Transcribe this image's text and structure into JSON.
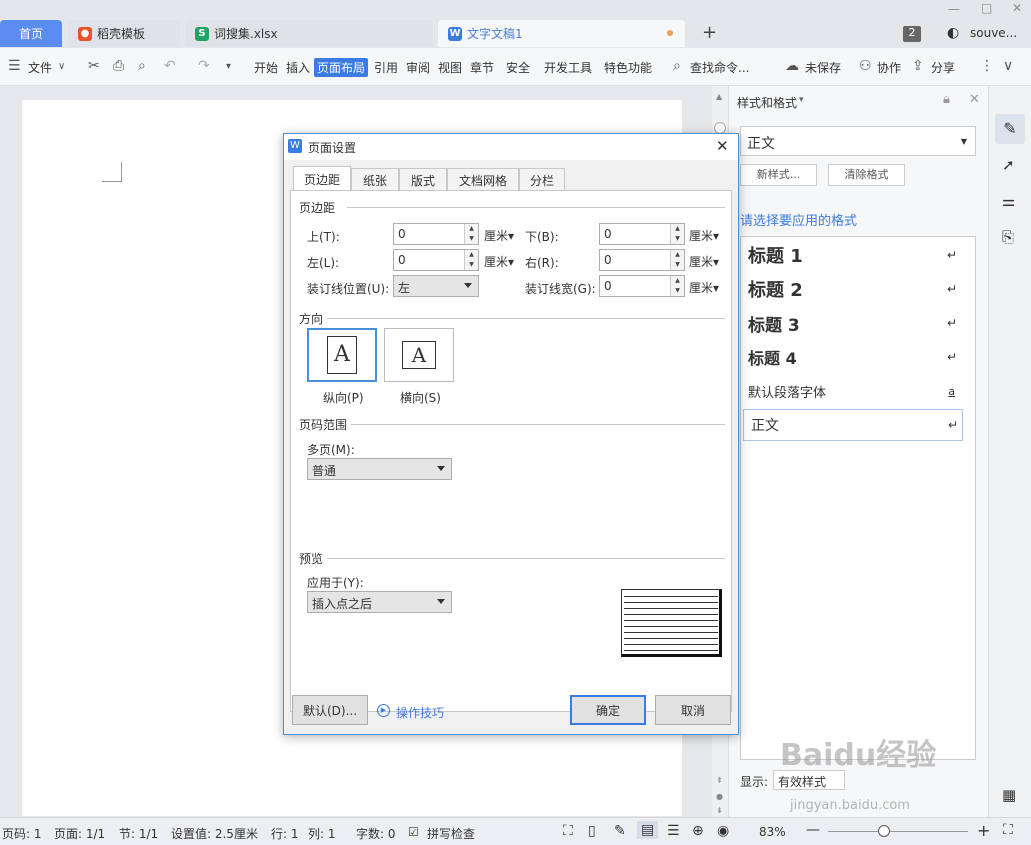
{
  "tabs": [
    {
      "label": "首页"
    },
    {
      "label": "稻壳模板"
    },
    {
      "label": "词搜集.xlsx"
    },
    {
      "label": "文字文稿1"
    }
  ],
  "titlebar": {
    "count_badge": "2",
    "user": "souve..."
  },
  "toolbar": {
    "file": "文件",
    "menus": [
      "开始",
      "插入",
      "页面布局",
      "引用",
      "审阅",
      "视图",
      "章节",
      "安全",
      "开发工具",
      "特色功能"
    ],
    "search": "查找命令...",
    "unsaved": "未保存",
    "collab": "协作",
    "share": "分享"
  },
  "panel": {
    "title": "样式和格式",
    "current_style": "正文",
    "new_style": "新样式...",
    "clear_format": "清除格式",
    "prompt": "请选择要应用的格式",
    "styles": [
      "标题 1",
      "标题 2",
      "标题 3",
      "标题 4",
      "默认段落字体",
      "正文"
    ],
    "show_label": "显示:",
    "show_value": "有效样式"
  },
  "dialog": {
    "title": "页面设置",
    "tabs": [
      "页边距",
      "纸张",
      "版式",
      "文档网格",
      "分栏"
    ],
    "margins_section": "页边距",
    "top_label": "上(T):",
    "top_value": "0",
    "bottom_label": "下(B):",
    "bottom_value": "0",
    "left_label": "左(L):",
    "left_value": "0",
    "right_label": "右(R):",
    "right_value": "0",
    "gutter_pos_label": "装订线位置(U):",
    "gutter_pos_value": "左",
    "gutter_width_label": "装订线宽(G):",
    "gutter_width_value": "0",
    "unit": "厘米",
    "orientation_section": "方向",
    "portrait": "纵向(P)",
    "landscape": "横向(S)",
    "pages_section": "页码范围",
    "multi_label": "多页(M):",
    "multi_value": "普通",
    "preview_section": "预览",
    "apply_label": "应用于(Y):",
    "apply_value": "插入点之后",
    "default_btn": "默认(D)...",
    "tips": "操作技巧",
    "ok": "确定",
    "cancel": "取消"
  },
  "status": {
    "page_num": "页码: 1",
    "pages": "页面: 1/1",
    "section": "节: 1/1",
    "setting": "设置值: 2.5厘米",
    "row": "行: 1",
    "col": "列: 1",
    "words": "字数: 0",
    "spell": "拼写检查",
    "zoom": "83%"
  },
  "watermark": {
    "brand": "Baidu经验",
    "url": "jingyan.baidu.com"
  },
  "colors": {
    "accent": "#3b7be3",
    "dialog_border": "#4a90d9",
    "title_blue": "#4a7fd6"
  }
}
